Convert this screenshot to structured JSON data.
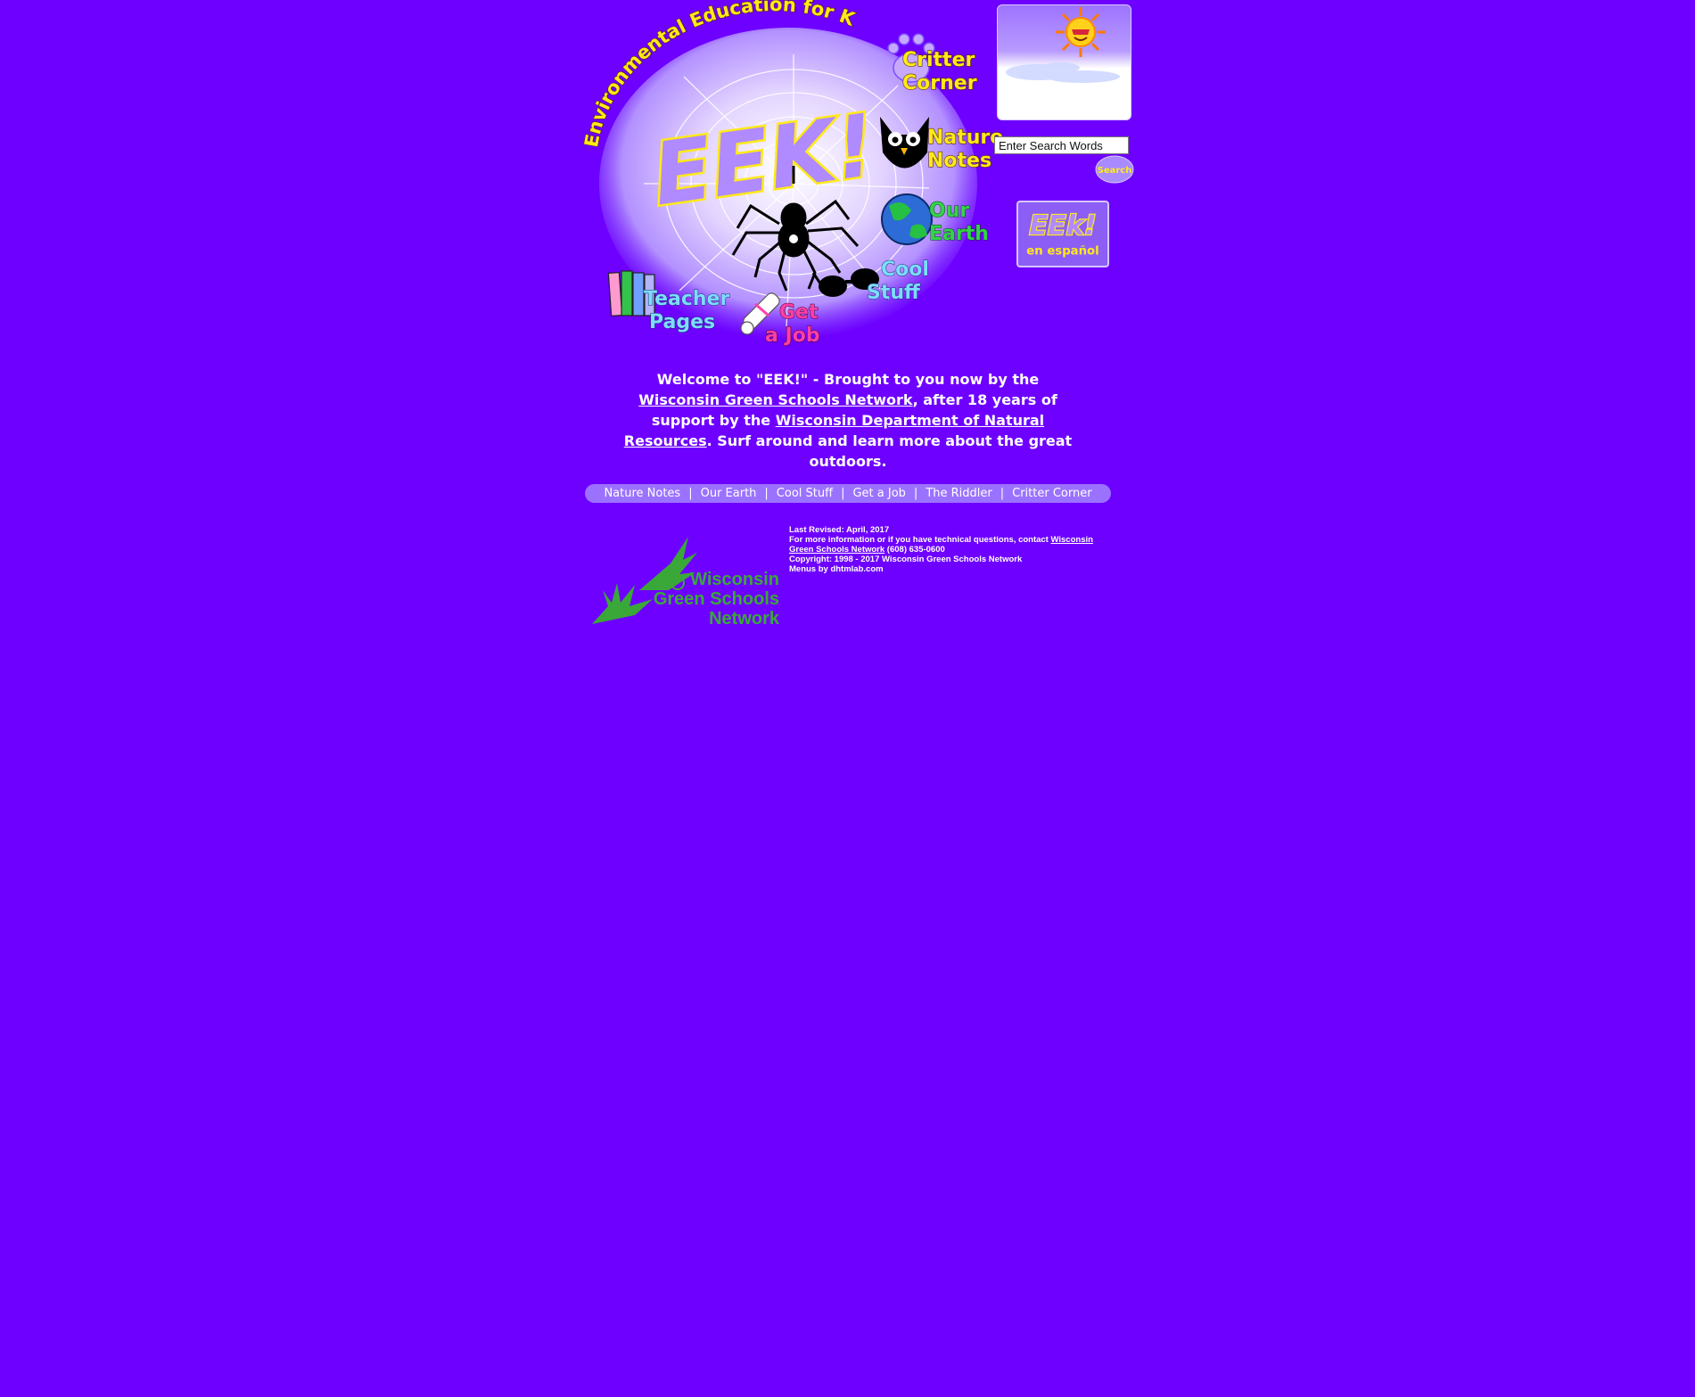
{
  "hero": {
    "tagline": "Environmental Education for Kids!",
    "logo_text": "EEK!",
    "links": [
      {
        "line1": "Critter",
        "line2": "Corner"
      },
      {
        "line1": "Nature",
        "line2": "Notes"
      },
      {
        "line1": "Our",
        "line2": "Earth"
      },
      {
        "line1": "Cool",
        "line2": "Stuff"
      },
      {
        "line1": "Teacher",
        "line2": "Pages"
      },
      {
        "line1": "Get",
        "line2": "a Job"
      }
    ]
  },
  "search": {
    "placeholder": "Enter Search Words",
    "value": "Enter Search Words",
    "button_label": "Search"
  },
  "espanol": {
    "logo_text": "EEk!",
    "label": "en español"
  },
  "welcome": {
    "part1": "Welcome to \"EEK!\" - Brought to you now by the ",
    "link1": "Wisconsin Green Schools Network",
    "part2": ", after 18 years of support by the ",
    "link2": "Wisconsin Department of Natural Resources",
    "part3": ". Surf around and learn more about the great outdoors."
  },
  "nav": {
    "items": [
      "Nature Notes",
      "Our Earth",
      "Cool Stuff",
      "Get a Job",
      "The Riddler",
      "Critter Corner"
    ],
    "separator": "|"
  },
  "footer": {
    "logo_lines": [
      "Wisconsin",
      "Green Schools",
      "Network"
    ],
    "last_revised": "Last Revised: April, 2017",
    "contact_prefix": "For more information or if you have technical questions, contact ",
    "contact_link": "Wisconsin Green Schools Network",
    "phone": " (608) 635-0600",
    "copyright": "Copyright: 1998 - 2017 Wisconsin Green Schools Network",
    "menus_credit": "Menus by dhtmlab.com"
  },
  "colors": {
    "background": "#6e00ff",
    "navbar": "#9b72ff",
    "logo_yellow": "#ffe91a",
    "wgsn_green": "#3aa838"
  }
}
